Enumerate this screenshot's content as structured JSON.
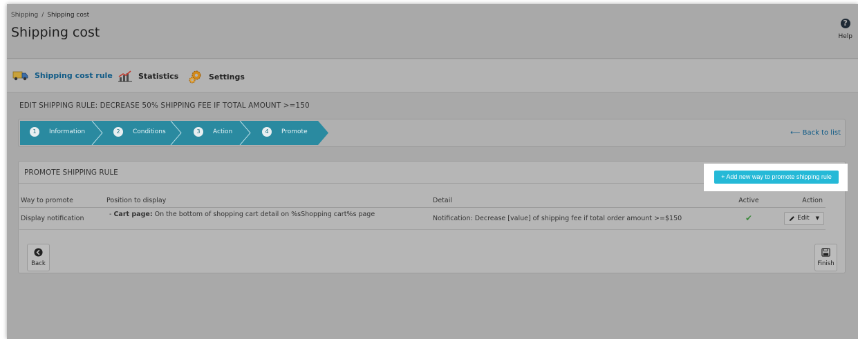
{
  "breadcrumb": {
    "parent": "Shipping",
    "separator": "/",
    "current": "Shipping cost"
  },
  "page": {
    "title": "Shipping cost",
    "help_label": "Help",
    "help_icon_glyph": "?"
  },
  "tabs": [
    {
      "label": "Shipping cost rule",
      "icon": "truck-icon",
      "active": true
    },
    {
      "label": "Statistics",
      "icon": "chart-icon",
      "active": false
    },
    {
      "label": "Settings",
      "icon": "gears-icon",
      "active": false
    }
  ],
  "rule": {
    "heading": "EDIT SHIPPING RULE: DECREASE 50% SHIPPING FEE IF TOTAL AMOUNT >=150"
  },
  "steps": [
    {
      "num": "1",
      "label": "Information"
    },
    {
      "num": "2",
      "label": "Conditions"
    },
    {
      "num": "3",
      "label": "Action"
    },
    {
      "num": "4",
      "label": "Promote"
    }
  ],
  "back_to_list": "⟵ Back to list",
  "promote": {
    "title": "PROMOTE SHIPPING RULE",
    "add_button": "+ Add new way to promote shipping rule",
    "columns": [
      "Way to promote",
      "Position to display",
      "Detail",
      "Active",
      "Action"
    ],
    "rows": [
      {
        "way": "Display notification",
        "position_prefix": "- ",
        "position_label": "Cart page:",
        "position_text": " On the bottom of shopping cart detail on %sShopping cart%s page",
        "detail": "Notification: Decrease [value] of shipping fee if total order amount >=$150",
        "active_glyph": "✔",
        "edit_label": "Edit"
      }
    ]
  },
  "footer": {
    "back_label": "Back",
    "finish_label": "Finish"
  },
  "colors": {
    "accent": "#25b9d7",
    "step_fill": "#2a8aa0",
    "link": "#0f5a86",
    "active_check": "#3f8b3f"
  }
}
